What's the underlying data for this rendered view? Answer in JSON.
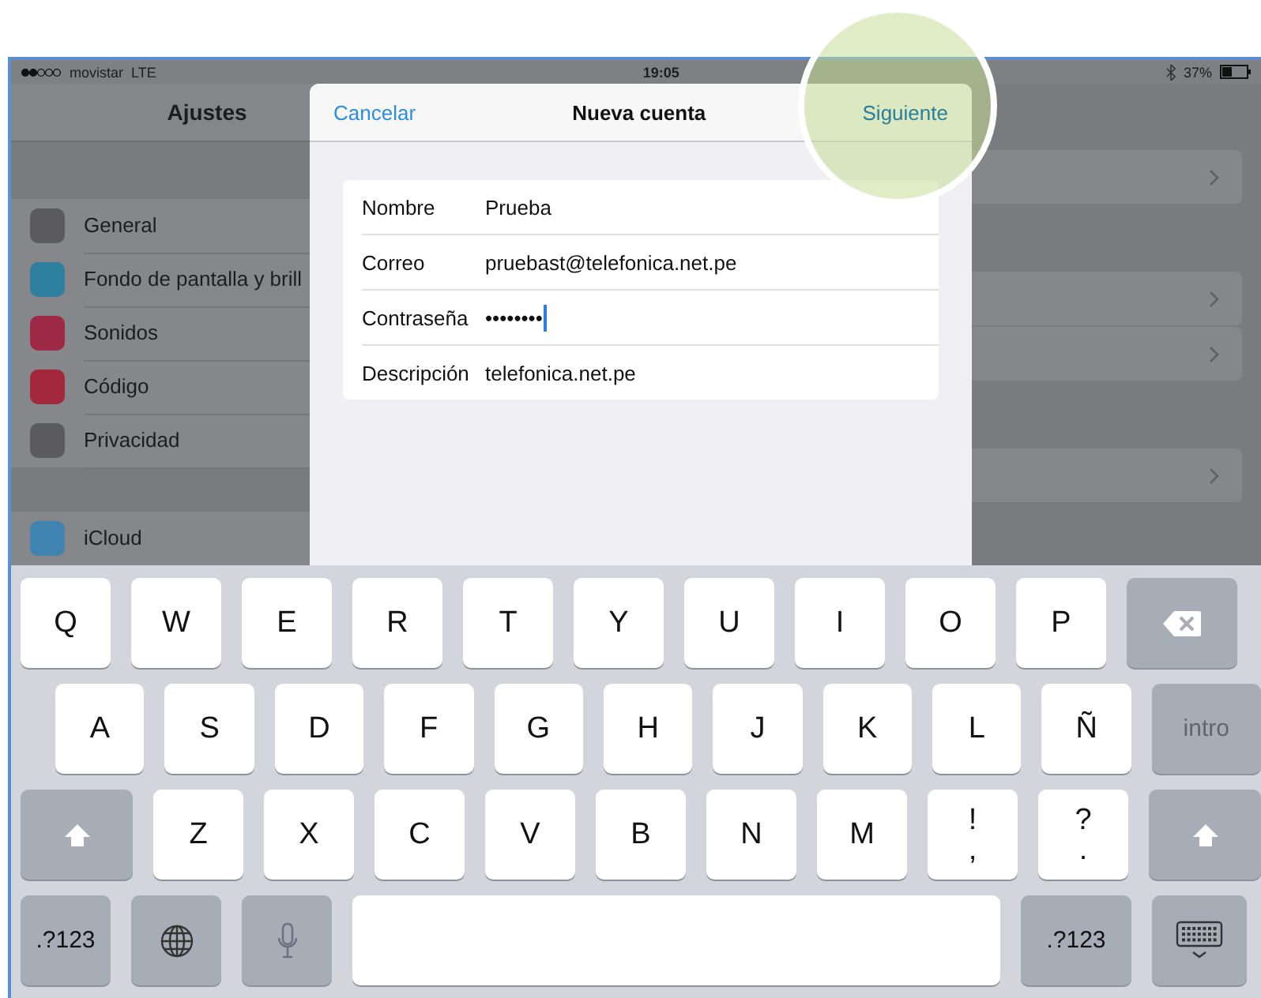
{
  "status_bar": {
    "carrier": "movistar",
    "network": "LTE",
    "time": "19:05",
    "battery": "37%"
  },
  "settings": {
    "title": "Ajustes",
    "groups": [
      [
        {
          "label": "General",
          "color": "#5b5b5f"
        },
        {
          "label": "Fondo de pantalla y brill",
          "color": "#2f7f9e"
        },
        {
          "label": "Sonidos",
          "color": "#9e2a45"
        },
        {
          "label": "Código",
          "color": "#a3283c"
        },
        {
          "label": "Privacidad",
          "color": "#5b5b5f"
        }
      ],
      [
        {
          "label": "iCloud",
          "color": "#3f83b0"
        }
      ]
    ]
  },
  "dialog": {
    "cancel": "Cancelar",
    "title": "Nueva cuenta",
    "next": "Siguiente",
    "fields": [
      {
        "label": "Nombre",
        "value": "Prueba",
        "focused": false
      },
      {
        "label": "Correo",
        "value": "pruebast@telefonica.net.pe",
        "focused": false
      },
      {
        "label": "Contraseña",
        "value": "••••••••",
        "focused": true
      },
      {
        "label": "Descripción",
        "value": "telefonica.net.pe",
        "focused": false
      }
    ]
  },
  "keyboard": {
    "rows": [
      {
        "keys": [
          {
            "kind": "letter",
            "label": "Q"
          },
          {
            "kind": "letter",
            "label": "W"
          },
          {
            "kind": "letter",
            "label": "E"
          },
          {
            "kind": "letter",
            "label": "R"
          },
          {
            "kind": "letter",
            "label": "T"
          },
          {
            "kind": "letter",
            "label": "Y"
          },
          {
            "kind": "letter",
            "label": "U"
          },
          {
            "kind": "letter",
            "label": "I"
          },
          {
            "kind": "letter",
            "label": "O"
          },
          {
            "kind": "letter",
            "label": "P"
          },
          {
            "kind": "backspace"
          }
        ]
      },
      {
        "keys": [
          {
            "kind": "letter",
            "label": "A"
          },
          {
            "kind": "letter",
            "label": "S"
          },
          {
            "kind": "letter",
            "label": "D"
          },
          {
            "kind": "letter",
            "label": "F"
          },
          {
            "kind": "letter",
            "label": "G"
          },
          {
            "kind": "letter",
            "label": "H"
          },
          {
            "kind": "letter",
            "label": "J"
          },
          {
            "kind": "letter",
            "label": "K"
          },
          {
            "kind": "letter",
            "label": "L"
          },
          {
            "kind": "letter",
            "label": "Ñ"
          },
          {
            "kind": "return",
            "label": "intro"
          }
        ]
      },
      {
        "keys": [
          {
            "kind": "shift"
          },
          {
            "kind": "letter",
            "label": "Z"
          },
          {
            "kind": "letter",
            "label": "X"
          },
          {
            "kind": "letter",
            "label": "C"
          },
          {
            "kind": "letter",
            "label": "V"
          },
          {
            "kind": "letter",
            "label": "B"
          },
          {
            "kind": "letter",
            "label": "N"
          },
          {
            "kind": "letter",
            "label": "M"
          },
          {
            "kind": "dual",
            "label": "!",
            "sub": ","
          },
          {
            "kind": "dual",
            "label": "?",
            "sub": "."
          },
          {
            "kind": "shift"
          }
        ]
      }
    ],
    "bottom_row": {
      "left_mode": ".?123",
      "right_mode": ".?123"
    }
  }
}
